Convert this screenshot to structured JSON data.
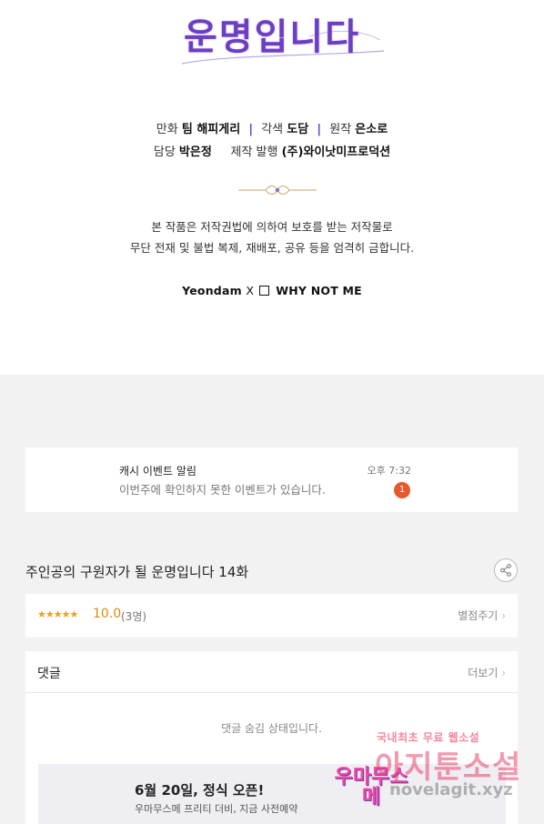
{
  "credits": {
    "title_line": "운명입니다",
    "line1": {
      "label_art": "만화",
      "art": "팀 해피게리",
      "label_adapt": "각색",
      "adapt": "도담",
      "label_original": "원작",
      "original": "은소로"
    },
    "line2": {
      "label_editor": "담당",
      "editor": "박은정",
      "label_publisher": "제작 발행",
      "publisher": "(주)와이낫미프로덕션"
    },
    "notice_line1": "본 작품은 저작권법에 의하여 보호를 받는 저작물로",
    "notice_line2": "무단 전재 및 불법 복제, 재배포, 공유 등을 엄격히 금합니다.",
    "logo_left": "Yeondam",
    "logo_x": "X",
    "logo_right": "WHY NOT ME"
  },
  "notification": {
    "title": "캐시 이벤트 알림",
    "body": "이번주에 확인하지 못한 이벤트가 있습니다.",
    "time": "오후 7:32",
    "badge": "1"
  },
  "episode": {
    "title": "주인공의 구원자가 될 운명입니다 14화"
  },
  "rating": {
    "stars": "★★★★★",
    "score": "10.0",
    "count": "(3명)",
    "rate_link": "별점주기"
  },
  "comments": {
    "heading": "댓글",
    "more": "더보기",
    "hidden_message": "댓글 숨김 상태입니다."
  },
  "banner": {
    "title": "6월 20일, 정식 오픈!",
    "subtitle": "우마무스메 프리티 더비, 지금 사전예약",
    "logo_text": "우마무스메"
  },
  "watermark": {
    "line1": "국내최초 무료 웹소설",
    "line2": "아지툰소설",
    "line3": "novelagit.xyz"
  },
  "colors": {
    "accent_purple": "#6b3fc2",
    "badge_red": "#e8582d",
    "rating_orange": "#e08a12",
    "separator_blue": "#4a4ad8"
  }
}
